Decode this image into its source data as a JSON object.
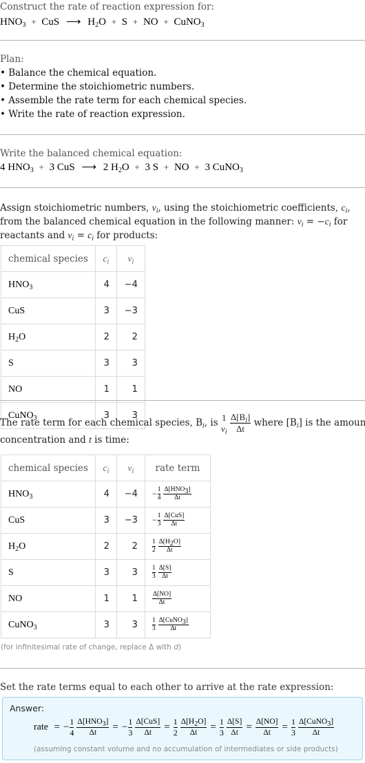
{
  "header": {
    "prompt": "Construct the rate of reaction expression for:",
    "reaction": {
      "reactants": [
        {
          "base": "HNO",
          "sub": "3"
        },
        {
          "base": "CuS",
          "sub": ""
        }
      ],
      "products": [
        {
          "base": "H",
          "sub": "2",
          "tail": "O"
        },
        {
          "base": "S",
          "sub": ""
        },
        {
          "base": "NO",
          "sub": ""
        },
        {
          "base": "CuNO",
          "sub": "3"
        }
      ],
      "plus": "+",
      "arrow": "⟶"
    }
  },
  "plan": {
    "label": "Plan:",
    "steps": [
      "• Balance the chemical equation.",
      "• Determine the stoichiometric numbers.",
      "• Assemble the rate term for each chemical species.",
      "• Write the rate of reaction expression."
    ]
  },
  "balanced": {
    "label": "Write the balanced chemical equation:",
    "coefficients": {
      "HNO3": "4",
      "CuS": "3",
      "H2O": "2",
      "S": "3",
      "NO": "",
      "CuNO3": "3"
    }
  },
  "stoich": {
    "text_1": "Assign stoichiometric numbers, ",
    "nu_i": "ν",
    "i": "i",
    "text_2": ", using the stoichiometric coefficients, ",
    "c_i": "c",
    "text_3": ", from the balanced chemical equation in the following manner: ",
    "rule_reactants": " = −",
    "text_4": " for reactants and ",
    "rule_products": " = ",
    "text_5": " for products:",
    "table": {
      "headers": [
        "chemical species",
        "c",
        "ν"
      ],
      "rows": [
        {
          "species": "HNO",
          "sub": "3",
          "tail": "",
          "c": "4",
          "nu": "−4"
        },
        {
          "species": "CuS",
          "sub": "",
          "tail": "",
          "c": "3",
          "nu": "−3"
        },
        {
          "species": "H",
          "sub": "2",
          "tail": "O",
          "c": "2",
          "nu": "2"
        },
        {
          "species": "S",
          "sub": "",
          "tail": "",
          "c": "3",
          "nu": "3"
        },
        {
          "species": "NO",
          "sub": "",
          "tail": "",
          "c": "1",
          "nu": "1"
        },
        {
          "species": "CuNO",
          "sub": "3",
          "tail": "",
          "c": "3",
          "nu": "3"
        }
      ]
    }
  },
  "rate_terms": {
    "text_1": "The rate term for each chemical species, B",
    "text_2": ", is ",
    "frac_num": "1",
    "frac_den": "ν",
    "delta_num": "Δ[B",
    "delta_den": "Δt",
    "text_3": " where [B",
    "text_4": "] is the amount concentration and ",
    "t": "t",
    "text_5": " is time:",
    "table": {
      "headers": [
        "chemical species",
        "c",
        "ν",
        "rate term"
      ],
      "rows": [
        {
          "species": "HNO",
          "sub": "3",
          "tail": "",
          "c": "4",
          "nu": "−4",
          "sign": "−",
          "coef": "4",
          "conc": "HNO",
          "conc_sub": "3",
          "conc_tail": ""
        },
        {
          "species": "CuS",
          "sub": "",
          "tail": "",
          "c": "3",
          "nu": "−3",
          "sign": "−",
          "coef": "3",
          "conc": "CuS",
          "conc_sub": "",
          "conc_tail": ""
        },
        {
          "species": "H",
          "sub": "2",
          "tail": "O",
          "c": "2",
          "nu": "2",
          "sign": "",
          "coef": "2",
          "conc": "H",
          "conc_sub": "2",
          "conc_tail": "O"
        },
        {
          "species": "S",
          "sub": "",
          "tail": "",
          "c": "3",
          "nu": "3",
          "sign": "",
          "coef": "3",
          "conc": "S",
          "conc_sub": "",
          "conc_tail": ""
        },
        {
          "species": "NO",
          "sub": "",
          "tail": "",
          "c": "1",
          "nu": "1",
          "sign": "",
          "coef": "",
          "conc": "NO",
          "conc_sub": "",
          "conc_tail": ""
        },
        {
          "species": "CuNO",
          "sub": "3",
          "tail": "",
          "c": "3",
          "nu": "3",
          "sign": "",
          "coef": "3",
          "conc": "CuNO",
          "conc_sub": "3",
          "conc_tail": ""
        }
      ]
    },
    "note_1": "(for infinitesimal rate of change, replace Δ with ",
    "note_d": "d",
    "note_2": ")"
  },
  "final": {
    "label": "Set the rate terms equal to each other to arrive at the rate expression:",
    "answer_label": "Answer:",
    "rate_word": "rate",
    "equals": "=",
    "delta_t": "Δt",
    "note": "(assuming constant volume and no accumulation of intermediates or side products)"
  },
  "colors": {
    "answer_bg": "#eaf8fd",
    "answer_border": "#9bd3e6",
    "separator": "#b3b3b3",
    "muted_text": "#888888"
  }
}
